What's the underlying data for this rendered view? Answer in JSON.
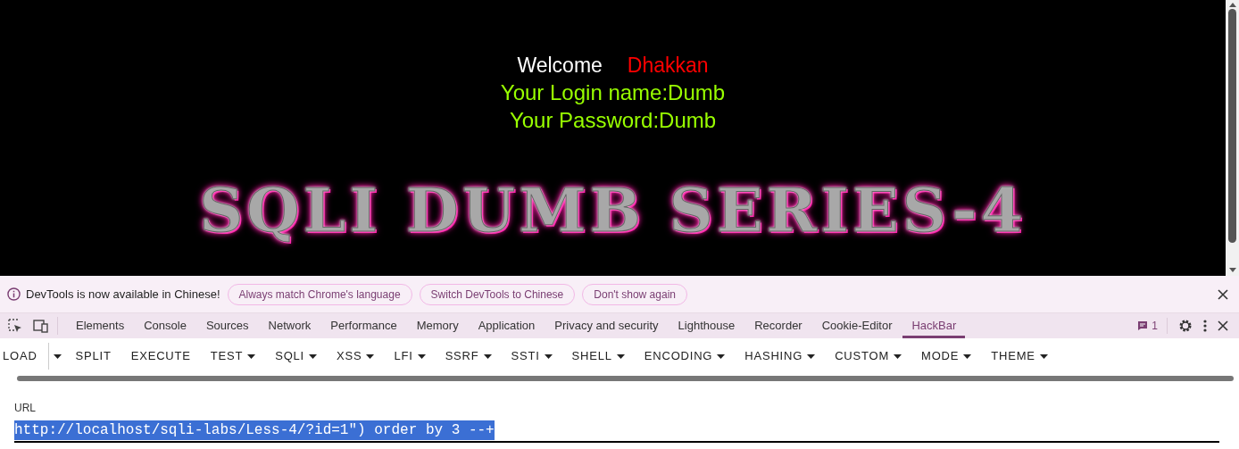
{
  "page": {
    "welcome": "Welcome",
    "user": "Dhakkan",
    "login_line": "Your Login name:Dumb",
    "password_line": "Your Password:Dumb",
    "banner": "SQLI DUMB SERIES-4"
  },
  "infobar": {
    "message": "DevTools is now available in Chinese!",
    "buttons": [
      "Always match Chrome's language",
      "Switch DevTools to Chinese",
      "Don't show again"
    ]
  },
  "devtools_tabs": [
    {
      "label": "Elements",
      "selected": false
    },
    {
      "label": "Console",
      "selected": false
    },
    {
      "label": "Sources",
      "selected": false
    },
    {
      "label": "Network",
      "selected": false
    },
    {
      "label": "Performance",
      "selected": false
    },
    {
      "label": "Memory",
      "selected": false
    },
    {
      "label": "Application",
      "selected": false
    },
    {
      "label": "Privacy and security",
      "selected": false
    },
    {
      "label": "Lighthouse",
      "selected": false
    },
    {
      "label": "Recorder",
      "selected": false
    },
    {
      "label": "Cookie-Editor",
      "selected": false
    },
    {
      "label": "HackBar",
      "selected": true
    }
  ],
  "issues_count": "1",
  "hackbar": {
    "menu": [
      {
        "label": "LOAD",
        "kind": "split"
      },
      {
        "label": "SPLIT",
        "kind": "button"
      },
      {
        "label": "EXECUTE",
        "kind": "button"
      },
      {
        "label": "TEST",
        "kind": "dropdown"
      },
      {
        "label": "SQLI",
        "kind": "dropdown"
      },
      {
        "label": "XSS",
        "kind": "dropdown"
      },
      {
        "label": "LFI",
        "kind": "dropdown"
      },
      {
        "label": "SSRF",
        "kind": "dropdown"
      },
      {
        "label": "SSTI",
        "kind": "dropdown"
      },
      {
        "label": "SHELL",
        "kind": "dropdown"
      },
      {
        "label": "ENCODING",
        "kind": "dropdown"
      },
      {
        "label": "HASHING",
        "kind": "dropdown"
      },
      {
        "label": "CUSTOM",
        "kind": "dropdown"
      },
      {
        "label": "MODE",
        "kind": "dropdown"
      },
      {
        "label": "THEME",
        "kind": "dropdown"
      }
    ],
    "url_label": "URL",
    "url_value": "http://localhost/sqli-labs/Less-4/?id=1\") order by 3 --+"
  }
}
